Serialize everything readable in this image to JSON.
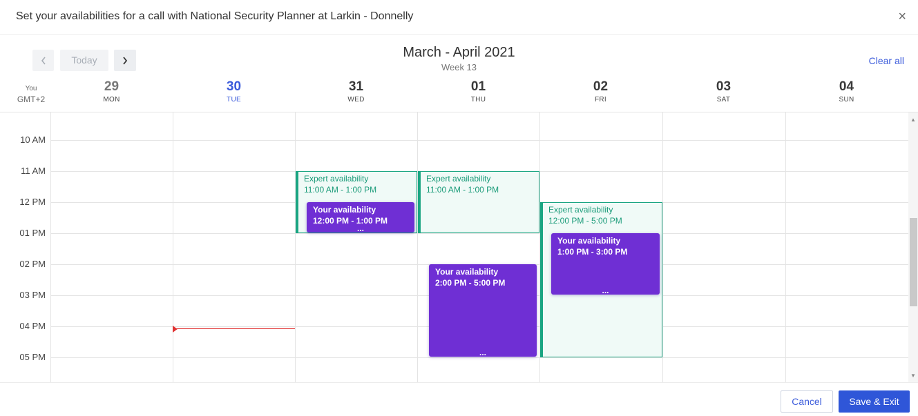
{
  "header": {
    "title": "Set your availabilities for a call with National Security Planner at Larkin - Donnelly",
    "close_icon": "close-icon",
    "close_glyph": "×"
  },
  "toolbar": {
    "today_label": "Today",
    "prev_icon": "chevron-left-icon",
    "next_icon": "chevron-right-icon",
    "month_label": "March - April 2021",
    "week_label": "Week 13",
    "clear_all_label": "Clear all"
  },
  "timezone": {
    "you_label": "You",
    "gmt_label": "GMT+2"
  },
  "days": [
    {
      "num": "29",
      "name": "MON",
      "state": "past"
    },
    {
      "num": "30",
      "name": "TUE",
      "state": "today"
    },
    {
      "num": "31",
      "name": "WED",
      "state": "future"
    },
    {
      "num": "01",
      "name": "THU",
      "state": "future"
    },
    {
      "num": "02",
      "name": "FRI",
      "state": "future"
    },
    {
      "num": "03",
      "name": "SAT",
      "state": "future"
    },
    {
      "num": "04",
      "name": "SUN",
      "state": "future"
    }
  ],
  "hours": [
    "10 AM",
    "11 AM",
    "12 PM",
    "01 PM",
    "02 PM",
    "03 PM",
    "04 PM",
    "05 PM"
  ],
  "expert_events": [
    {
      "day": "31 WED",
      "title": "Expert availability",
      "time": "11:00 AM - 1:00 PM"
    },
    {
      "day": "01 THU",
      "title": "Expert availability",
      "time": "11:00 AM - 1:00 PM"
    },
    {
      "day": "02 FRI",
      "title": "Expert availability",
      "time": "12:00 PM - 5:00 PM"
    }
  ],
  "your_events": [
    {
      "day": "31 WED",
      "title": "Your availability",
      "time": "12:00 PM - 1:00 PM",
      "more": "..."
    },
    {
      "day": "01 THU",
      "title": "Your availability",
      "time": "2:00 PM - 5:00 PM",
      "more": "..."
    },
    {
      "day": "02 FRI",
      "title": "Your availability",
      "time": "1:00 PM - 3:00 PM",
      "more": "..."
    }
  ],
  "colors": {
    "accent": "#3b5bdb",
    "expert": "#1aa582",
    "yours": "#6f2fd4",
    "now_line": "#e03131",
    "save_button": "#2f56d8"
  },
  "footer": {
    "cancel_label": "Cancel",
    "save_label": "Save & Exit"
  }
}
